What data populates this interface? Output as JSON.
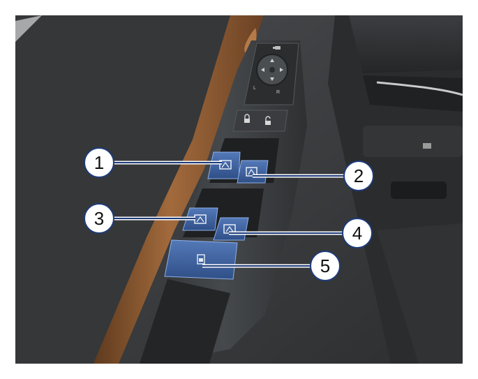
{
  "mirror_control": {
    "left_label": "L",
    "right_label": "R"
  },
  "callouts": [
    {
      "number": "1",
      "target": "front-left-window-switch"
    },
    {
      "number": "2",
      "target": "front-right-window-switch"
    },
    {
      "number": "3",
      "target": "rear-left-window-switch"
    },
    {
      "number": "4",
      "target": "rear-right-window-switch"
    },
    {
      "number": "5",
      "target": "window-lock-switch"
    }
  ],
  "colors": {
    "highlight": "#3a5f9e",
    "leader": "#1d3b7a",
    "door_trim": "#8a5a32",
    "panel": "#3f4245"
  },
  "icons": {
    "mirror": "mirror-icon",
    "lock": "padlock-icon",
    "unlock": "unlock-icon",
    "window": "window-icon",
    "window_lock": "window-lock-icon"
  }
}
